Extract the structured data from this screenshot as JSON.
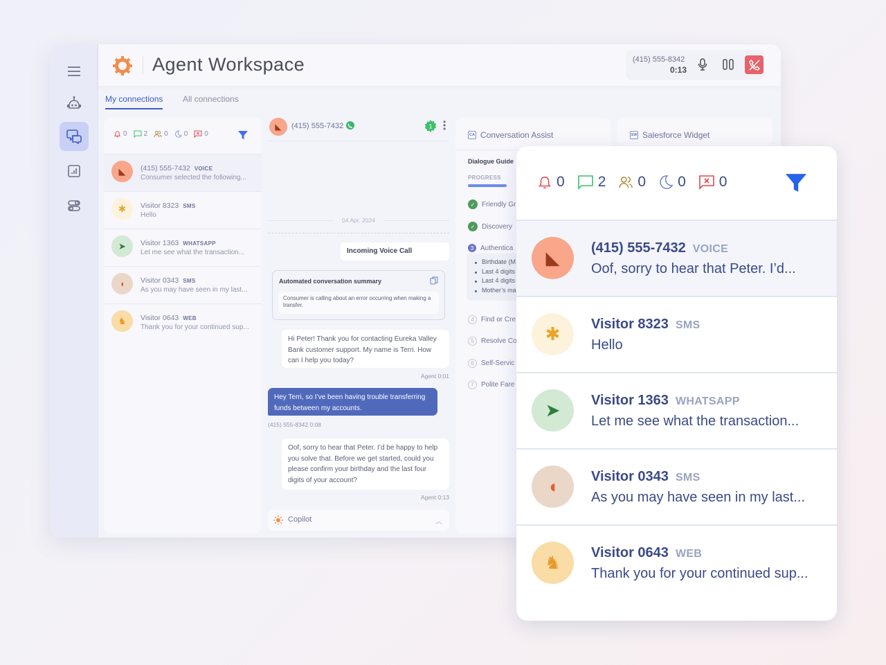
{
  "app": {
    "title": "Agent Workspace"
  },
  "sidebar": {
    "items": [
      {
        "name": "menu",
        "icon": "hamburger-icon"
      },
      {
        "name": "bot",
        "icon": "robot-icon"
      },
      {
        "name": "conversations",
        "icon": "chat-bubbles-icon",
        "active": true
      },
      {
        "name": "reports",
        "icon": "bar-chart-icon"
      },
      {
        "name": "settings",
        "icon": "toggles-icon"
      }
    ]
  },
  "call": {
    "number": "(415) 555-8342",
    "duration": "0:13"
  },
  "tabs": [
    {
      "label": "My connections",
      "active": true
    },
    {
      "label": "All connections",
      "active": false
    }
  ],
  "counters": [
    {
      "icon": "bell-icon",
      "value": "0",
      "color": "#e0474f"
    },
    {
      "icon": "message-icon",
      "value": "2",
      "color": "#3cbf6a"
    },
    {
      "icon": "group-icon",
      "value": "0",
      "color": "#b08a3a"
    },
    {
      "icon": "moon-icon",
      "value": "0",
      "color": "#6a80c9"
    },
    {
      "icon": "message-x-icon",
      "value": "0",
      "color": "#e0474f"
    }
  ],
  "connections": [
    {
      "name": "(415) 555-7432",
      "channel": "VOICE",
      "preview": "Consumer selected the following...",
      "preview_large": "Oof, sorry to hear that Peter. I’d...",
      "avatar": "cardinal",
      "avatar_bg": "#f9a68a"
    },
    {
      "name": "Visitor 8323",
      "channel": "SMS",
      "preview": "Hello",
      "preview_large": "Hello",
      "avatar": "bee",
      "avatar_bg": "#fdf2dc"
    },
    {
      "name": "Visitor 1363",
      "channel": "WHATSAPP",
      "preview": "Let me see what the transaction...",
      "preview_large": "Let me see what the transaction...",
      "avatar": "crocodile",
      "avatar_bg": "#d2e9d3"
    },
    {
      "name": "Visitor 0343",
      "channel": "SMS",
      "preview": "As you may have seen in my last...",
      "preview_large": "As you may have seen in my last...",
      "avatar": "armadillo",
      "avatar_bg": "#ebd7c8"
    },
    {
      "name": "Visitor 0643",
      "channel": "WEB",
      "preview": "Thank you for your continued sup...",
      "preview_large": "Thank you for your continued sup...",
      "avatar": "antelope",
      "avatar_bg": "#f9dca6"
    }
  ],
  "chat": {
    "contact": "(415) 555-7432",
    "badge": "1",
    "date": "04 Apr. 2024",
    "incoming": "Incoming Voice Call",
    "summary_title": "Automated conversation summary",
    "summary_text": "Consumer is calling about an error occurring when making a transfer.",
    "messages": [
      {
        "from": "agent",
        "text": "Hi Peter! Thank you for contacting Eureka Valley Bank customer support. My name is Terri. How can I help you today?",
        "meta": "Agent  0:01"
      },
      {
        "from": "customer",
        "text": "Hey Terri, so I’ve been having trouble transferring funds between my accounts.",
        "meta": "(415) 555-8342  0:08"
      },
      {
        "from": "agent",
        "text": "Oof, sorry to hear that Peter. I’d be happy to help you solve that. Before we get started, could you please confirm your birthday and the last four digits of your account?",
        "meta": "Agent  0:13"
      }
    ],
    "copilot": "Copilot"
  },
  "assist": {
    "title": "Conversation Assist",
    "icon_text": "CA",
    "guide": "Dialogue Guide",
    "progress_label": "PROGRESS",
    "progress": 0.35,
    "steps": [
      {
        "n": "1",
        "label": "Friendly Gr",
        "state": "done"
      },
      {
        "n": "2",
        "label": "Discovery",
        "state": "done"
      },
      {
        "n": "3",
        "label": "Authentica",
        "state": "current"
      },
      {
        "n": "4",
        "label": "Find or Cre",
        "state": "todo"
      },
      {
        "n": "5",
        "label": "Resolve Co",
        "state": "todo"
      },
      {
        "n": "6",
        "label": "Self-Servic",
        "state": "todo"
      },
      {
        "n": "7",
        "label": "Polite Fare",
        "state": "todo"
      }
    ],
    "auth_items": [
      "Birthdate (M",
      "Last 4 digits",
      "Last 4 digits",
      "Mother’s ma"
    ]
  },
  "salesforce": {
    "title": "Salesforce Widget",
    "icon_text": "SW"
  }
}
